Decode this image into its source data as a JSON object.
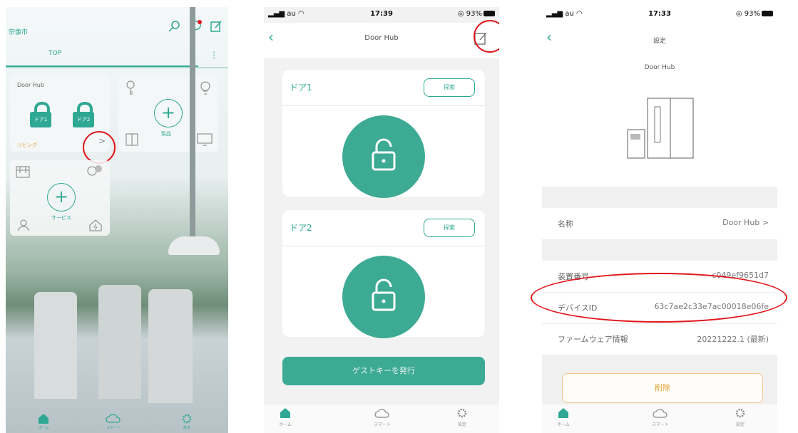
{
  "screen1": {
    "city": "宗像市",
    "tab": "TOP",
    "doorhub_card": {
      "title": "Door Hub",
      "lock1": "ドア1",
      "lock2": "ドア2",
      "room": "リビング",
      "chevron": ">"
    },
    "product_card": {
      "label": "製品"
    },
    "service_card": {
      "label": "サービス"
    },
    "nav": [
      "ホーム",
      "スマート",
      "設定"
    ]
  },
  "screen2": {
    "status": {
      "carrier": "au",
      "time": "17:39",
      "battery": "93%"
    },
    "title": "Door Hub",
    "doors": [
      {
        "name": "ドア1",
        "search": "探索"
      },
      {
        "name": "ドア2",
        "search": "探索"
      }
    ],
    "guest_key_button": "ゲストキーを発行",
    "nav": [
      "ホーム",
      "スマート",
      "設定"
    ]
  },
  "screen3": {
    "status": {
      "carrier": "au",
      "time": "17:33",
      "battery": "93%"
    },
    "title": "設定",
    "device_name": "Door Hub",
    "rows": {
      "name": {
        "label": "名称",
        "value": "Door Hub >"
      },
      "serial": {
        "label": "装置番号",
        "value": "c049ef9651d7"
      },
      "device_id": {
        "label": "デバイスID",
        "value": "63c7ae2c33e7ac00018e06fe"
      },
      "firmware": {
        "label": "ファームウェア情報",
        "value": "20221222.1 (最新)"
      }
    },
    "delete_button": "削除",
    "nav": [
      "ホーム",
      "スマート",
      "設定"
    ]
  },
  "colors": {
    "accent": "#2fa893",
    "highlight": "#e0161c",
    "warning": "#e2a033"
  }
}
